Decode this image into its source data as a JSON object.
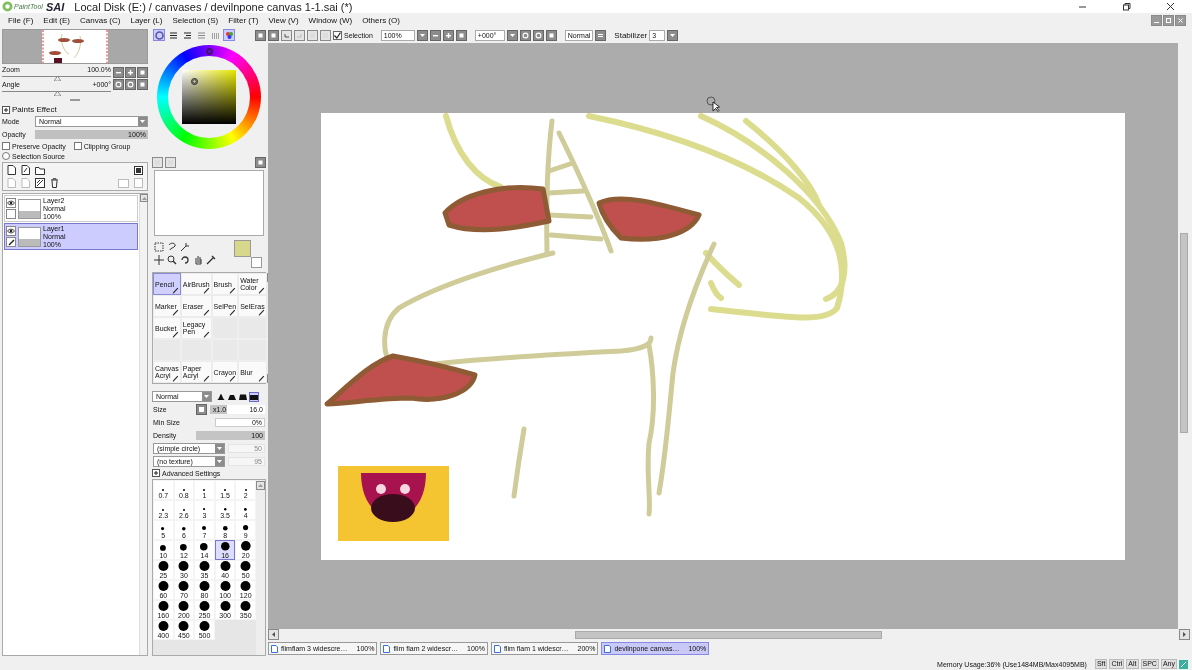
{
  "window": {
    "logo_small": "PaintTool",
    "logo_big": "SAI",
    "title": "Local Disk (E:) / canvases / devilnpone canvas 1-1.sai (*)"
  },
  "menu": [
    "File (F)",
    "Edit (E)",
    "Canvas (C)",
    "Layer (L)",
    "Selection (S)",
    "Filter (T)",
    "View (V)",
    "Window (W)",
    "Others (O)"
  ],
  "navigator": {
    "zoom": {
      "label": "Zoom",
      "value": "100.0%",
      "level": 0.5
    },
    "angle": {
      "label": "Angle",
      "value": "+000°",
      "level": 0.5
    }
  },
  "layer_settings": {
    "title": "Paints Effect",
    "mode": {
      "label": "Mode",
      "value": "Normal"
    },
    "opacity": {
      "label": "Opacity",
      "value": "100%",
      "level": 1
    },
    "options": [
      {
        "label": "Preserve Opacity",
        "checked": false
      },
      {
        "label": "Clipping Group",
        "checked": false
      }
    ],
    "selection_source": {
      "label": "Selection Source",
      "selected": false
    }
  },
  "layers": [
    {
      "name": "Layer2",
      "mode": "Normal",
      "opacity": "100%",
      "visible": true,
      "selected": false
    },
    {
      "name": "Layer1",
      "mode": "Normal",
      "opacity": "100%",
      "visible": true,
      "selected": true
    }
  ],
  "color_tabs": [
    {
      "kind": "wheel",
      "selected": true
    },
    {
      "kind": "rgb",
      "selected": false
    },
    {
      "kind": "hsv",
      "selected": false
    },
    {
      "kind": "gradient",
      "selected": false
    },
    {
      "kind": "swatches",
      "selected": false
    },
    {
      "kind": "mixer",
      "selected": true
    }
  ],
  "tools": [
    {
      "kind": "tool",
      "label": "Pencil",
      "selected": true
    },
    {
      "kind": "tool",
      "label": "AirBrush",
      "selected": false
    },
    {
      "kind": "tool",
      "label": "Brush",
      "selected": false
    },
    {
      "kind": "tool",
      "label": "Water Color",
      "selected": false
    },
    {
      "kind": "tool",
      "label": "Marker",
      "selected": false
    },
    {
      "kind": "tool",
      "label": "Eraser",
      "selected": false
    },
    {
      "kind": "tool",
      "label": "SelPen",
      "selected": false
    },
    {
      "kind": "tool",
      "label": "SelEras",
      "selected": false
    },
    {
      "kind": "tool",
      "label": "Bucket",
      "selected": false
    },
    {
      "kind": "tool",
      "label": "Legacy Pen",
      "selected": false
    },
    {
      "kind": "blank"
    },
    {
      "kind": "blank"
    },
    {
      "kind": "blank"
    },
    {
      "kind": "blank"
    },
    {
      "kind": "blank"
    },
    {
      "kind": "blank"
    },
    {
      "kind": "tool",
      "label": "Canvas Acryl",
      "selected": false
    },
    {
      "kind": "tool",
      "label": "Paper Acryl",
      "selected": false
    },
    {
      "kind": "tool",
      "label": "Crayon",
      "selected": false
    },
    {
      "kind": "tool",
      "label": "Blur",
      "selected": false
    }
  ],
  "brush": {
    "blend_mode": "Normal",
    "size": {
      "label": "Size",
      "multiplier": "x1.0",
      "value": "16.0",
      "level": 0.3
    },
    "min_size": {
      "label": "Min Size",
      "value": "0%"
    },
    "density": {
      "label": "Density",
      "value": "100",
      "level": 1
    },
    "shape": {
      "value": "(simple circle)",
      "amount": "50"
    },
    "texture": {
      "value": "(no texture)",
      "amount": "95"
    },
    "advanced": "Advanced Settings"
  },
  "edge_hardness": [
    {
      "selected": false
    },
    {
      "selected": false
    },
    {
      "selected": false
    },
    {
      "selected": true
    }
  ],
  "brush_sizes": [
    {
      "label": "0.7",
      "selected": false
    },
    {
      "label": "0.8",
      "selected": false
    },
    {
      "label": "1",
      "selected": false
    },
    {
      "label": "1.5",
      "selected": false
    },
    {
      "label": "2",
      "selected": false
    },
    {
      "label": "2.3",
      "selected": false
    },
    {
      "label": "2.6",
      "selected": false
    },
    {
      "label": "3",
      "selected": false
    },
    {
      "label": "3.5",
      "selected": false
    },
    {
      "label": "4",
      "selected": false
    },
    {
      "label": "5",
      "selected": false
    },
    {
      "label": "6",
      "selected": false
    },
    {
      "label": "7",
      "selected": false
    },
    {
      "label": "8",
      "selected": false
    },
    {
      "label": "9",
      "selected": false
    },
    {
      "label": "10",
      "selected": false
    },
    {
      "label": "12",
      "selected": false
    },
    {
      "label": "14",
      "selected": false
    },
    {
      "label": "16",
      "selected": true
    },
    {
      "label": "20",
      "selected": false
    },
    {
      "label": "25",
      "selected": false
    },
    {
      "label": "30",
      "selected": false
    },
    {
      "label": "35",
      "selected": false
    },
    {
      "label": "40",
      "selected": false
    },
    {
      "label": "50",
      "selected": false
    },
    {
      "label": "60",
      "selected": false
    },
    {
      "label": "70",
      "selected": false
    },
    {
      "label": "80",
      "selected": false
    },
    {
      "label": "100",
      "selected": false
    },
    {
      "label": "120",
      "selected": false
    },
    {
      "label": "160",
      "selected": false
    },
    {
      "label": "200",
      "selected": false
    },
    {
      "label": "250",
      "selected": false
    },
    {
      "label": "300",
      "selected": false
    },
    {
      "label": "350",
      "selected": false
    },
    {
      "label": "400",
      "selected": false
    },
    {
      "label": "450",
      "selected": false
    },
    {
      "label": "500",
      "selected": false
    }
  ],
  "toolbar": {
    "selection": {
      "label": "Selection",
      "checked": true
    },
    "zoom": "100%",
    "angle": "+000°",
    "mode": "Normal",
    "stabilizer": {
      "label": "Stabilizer",
      "value": "3"
    }
  },
  "documents": [
    {
      "name": "flimflam 3 widescre…",
      "zoom": "100%",
      "selected": false
    },
    {
      "name": "flim flam 2 widescr…",
      "zoom": "100%",
      "selected": false
    },
    {
      "name": "flim flam 1 widescr…",
      "zoom": "200%",
      "selected": false
    },
    {
      "name": "devilnpone canvas…",
      "zoom": "100%",
      "selected": true
    }
  ],
  "status": {
    "memory": "Memory Usage:36% (Use1484MB/Max4095MB)",
    "keys": [
      "Sft",
      "Ctrl",
      "Alt",
      "SPC",
      "Any"
    ]
  }
}
